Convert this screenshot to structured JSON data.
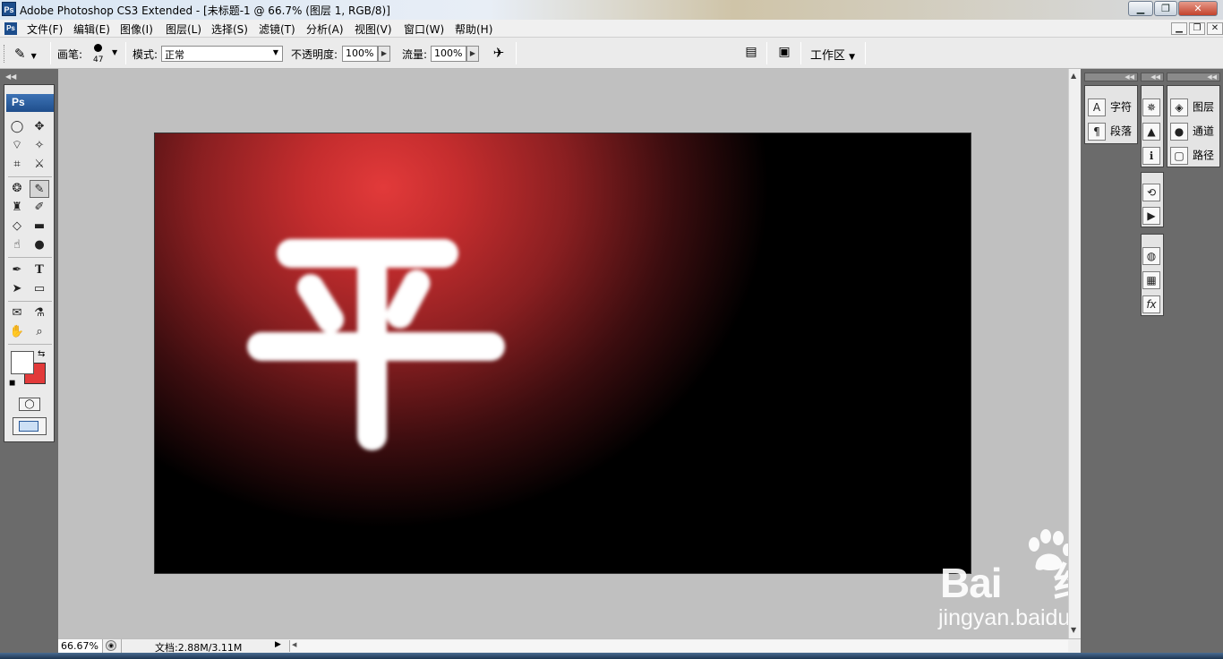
{
  "window": {
    "app_icon": "Ps",
    "title": "Adobe Photoshop CS3 Extended - [未标题-1 @ 66.7% (图层 1, RGB/8)]",
    "minimize_icon": "minimize-icon",
    "maximize_icon": "maximize-icon",
    "close_icon": "close-icon"
  },
  "menubar": {
    "items": [
      "文件(F)",
      "编辑(E)",
      "图像(I)",
      "图层(L)",
      "选择(S)",
      "滤镜(T)",
      "分析(A)",
      "视图(V)",
      "窗口(W)",
      "帮助(H)"
    ]
  },
  "options": {
    "brush_label": "画笔:",
    "brush_size": "47",
    "mode_label": "模式:",
    "mode_value": "正常",
    "opacity_label": "不透明度:",
    "opacity_value": "100%",
    "flow_label": "流量:",
    "flow_value": "100%",
    "workspace_label": "工作区"
  },
  "toolbox": {
    "header": "Ps",
    "foreground_color": "#ffffff",
    "background_color": "#e23a3a"
  },
  "canvas": {
    "text": "平",
    "gradient_highlight": "#e23a3a",
    "gradient_dark": "#000000"
  },
  "status": {
    "zoom": "66.67%",
    "doc_info": "文档:2.88M/3.11M"
  },
  "panels": {
    "group1": [
      {
        "icon": "character-icon",
        "glyph": "A",
        "label": "字符"
      },
      {
        "icon": "paragraph-icon",
        "glyph": "¶",
        "label": "段落"
      }
    ],
    "group3": [
      {
        "icon": "layers-icon",
        "glyph": "◈",
        "label": "图层"
      },
      {
        "icon": "channels-icon",
        "glyph": "●",
        "label": "通道"
      },
      {
        "icon": "paths-icon",
        "glyph": "▢",
        "label": "路径"
      }
    ]
  },
  "watermark": {
    "brand": "Bai",
    "brand2": "经验",
    "url": "jingyan.baidu.com"
  }
}
